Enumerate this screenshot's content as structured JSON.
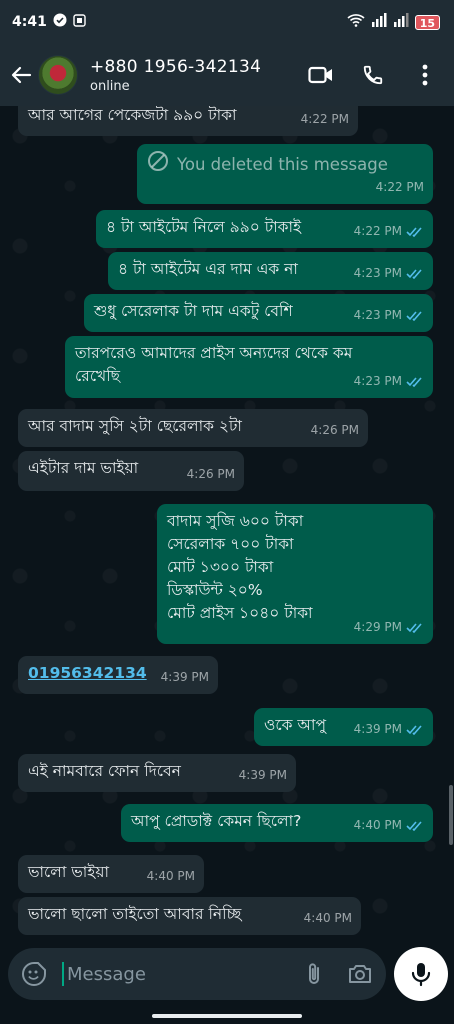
{
  "status_bar": {
    "time": "4:41",
    "battery": "15"
  },
  "header": {
    "contact_name": "+880 1956-342134",
    "status": "online"
  },
  "messages": [
    {
      "dir": "in",
      "text": "আর আগের পেকেজটা ৯৯০ টাকা",
      "time": "4:22 PM"
    },
    {
      "dir": "out",
      "deleted": true,
      "text": "You deleted this message",
      "time": "4:22 PM"
    },
    {
      "dir": "out",
      "text": "৪ টা আইটেম নিলে ৯৯০ টাকাই",
      "time": "4:22 PM"
    },
    {
      "dir": "out",
      "text": "৪ টা আইটেম এর দাম এক না",
      "time": "4:23 PM"
    },
    {
      "dir": "out",
      "text": "শুধু সেরেলাক টা দাম একটু বেশি",
      "time": "4:23 PM"
    },
    {
      "dir": "out",
      "text": "তারপরেও আমাদের প্রাইস অন্যদের থেকে কম\nরেখেছি",
      "time": "4:23 PM"
    },
    {
      "dir": "in",
      "text": "আর বাদাম সুসি ২টা ছেরেলাক ২টা",
      "time": "4:26 PM"
    },
    {
      "dir": "in",
      "text": "এইটার দাম ভাইয়া",
      "time": "4:26 PM"
    },
    {
      "dir": "out",
      "text": "বাদাম সুজি ৬০০ টাকা\nসেরেলাক ৭০০ টাকা\nমোট ১৩০০ টাকা\nডিস্কাউন্ট ২০%\nমোট প্রাইস ১০৪০ টাকা",
      "time": "4:29 PM"
    },
    {
      "dir": "in",
      "link": true,
      "text": "01956342134",
      "time": "4:39 PM"
    },
    {
      "dir": "out",
      "text": "ওকে আপু",
      "time": "4:39 PM"
    },
    {
      "dir": "in",
      "text": "এই নামবারে ফোন দিবেন",
      "time": "4:39 PM"
    },
    {
      "dir": "out",
      "text": "আপু প্রোডাক্ট কেমন ছিলো?",
      "time": "4:40 PM"
    },
    {
      "dir": "in",
      "text": "ভালো ভাইয়া",
      "time": "4:40 PM"
    },
    {
      "dir": "in",
      "text": "ভালো ছালো তাইতো আবার নিচ্ছি",
      "time": "4:40 PM"
    }
  ],
  "composer": {
    "placeholder": "Message"
  },
  "colors": {
    "incoming": "#202c33",
    "outgoing": "#005c4b",
    "read_ticks": "#53bdeb",
    "link": "#53bdeb"
  },
  "icons": [
    "back-arrow-icon",
    "video-call-icon",
    "voice-call-icon",
    "more-options-icon",
    "emoji-icon",
    "attach-icon",
    "camera-icon",
    "mic-icon",
    "blocked-icon",
    "double-check-icon"
  ]
}
